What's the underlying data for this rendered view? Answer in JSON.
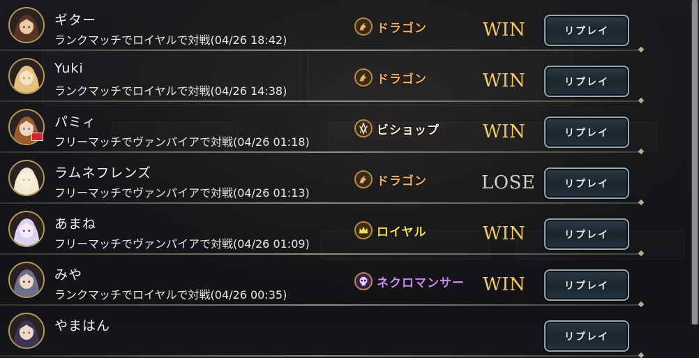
{
  "colors": {
    "name": "#f1f1f1",
    "desc": "#e8e8e8",
    "win": "#f4c95d",
    "lose": "#cfcfcf",
    "dragon": "#f0b25a",
    "bishop": "#f4f0e0",
    "royal": "#f2e24a",
    "necromancer": "#c98cff"
  },
  "replay_label": "リプレイ",
  "rows": [
    {
      "name": "ギター",
      "desc": "ランクマッチでロイヤルで対戦(04/26 18:42)",
      "class_label": "ドラゴン",
      "class_icon": "dragon-icon",
      "class_color": "#f0b25a",
      "result": "WIN",
      "result_color": "#f4c95d",
      "flag": false
    },
    {
      "name": "Yuki",
      "desc": "ランクマッチでロイヤルで対戦(04/26 14:38)",
      "class_label": "ドラゴン",
      "class_icon": "dragon-icon",
      "class_color": "#f0b25a",
      "result": "WIN",
      "result_color": "#f4c95d",
      "flag": false
    },
    {
      "name": "パミィ",
      "desc": "フリーマッチでヴァンパイアで対戦(04/26 01:18)",
      "class_label": "ビショップ",
      "class_icon": "bishop-icon",
      "class_color": "#f4f0e0",
      "result": "WIN",
      "result_color": "#f4c95d",
      "flag": true
    },
    {
      "name": "ラムネフレンズ",
      "desc": "フリーマッチでヴァンパイアで対戦(04/26 01:13)",
      "class_label": "ドラゴン",
      "class_icon": "dragon-icon",
      "class_color": "#f0b25a",
      "result": "LOSE",
      "result_color": "#cfcfcf",
      "flag": false
    },
    {
      "name": "あまね",
      "desc": "フリーマッチでヴァンパイアで対戦(04/26 01:09)",
      "class_label": "ロイヤル",
      "class_icon": "royal-icon",
      "class_color": "#f2e24a",
      "result": "WIN",
      "result_color": "#f4c95d",
      "flag": false
    },
    {
      "name": "みや",
      "desc": "ランクマッチでロイヤルで対戦(04/26 00:35)",
      "class_label": "ネクロマンサー",
      "class_icon": "necromancer-icon",
      "class_color": "#c98cff",
      "result": "WIN",
      "result_color": "#f4c95d",
      "flag": false
    },
    {
      "name": "やまはん",
      "desc": "",
      "class_label": "",
      "class_icon": "",
      "class_color": "#f0b25a",
      "result": "",
      "result_color": "#f4c95d",
      "flag": false
    }
  ]
}
